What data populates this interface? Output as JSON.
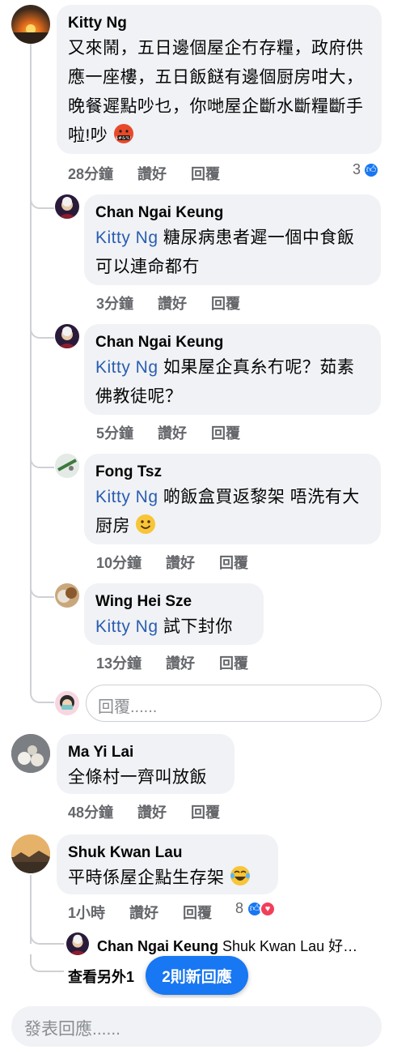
{
  "comments": [
    {
      "author": "Kitty Ng",
      "text": "又來鬧，五日邊個屋企冇存糧，政府供應一座樓，五日飯餸有邊個厨房咁大，晚餐遲點吵乜，你哋屋企斷水斷糧斷手啦!吵",
      "emoji": "angry-cursing-emoji",
      "time": "28分鐘",
      "like_label": "讚好",
      "reply_label": "回覆",
      "reaction_count": "3"
    },
    {
      "author": "Chan Ngai Keung",
      "tag": "Kitty Ng",
      "text": " 糖尿病患者遲一個中食飯可以連命都冇",
      "time": "3分鐘",
      "like_label": "讚好",
      "reply_label": "回覆"
    },
    {
      "author": "Chan Ngai Keung",
      "tag": "Kitty Ng",
      "text": " 如果屋企真糸冇呢？茹素佛教徒呢？",
      "time": "5分鐘",
      "like_label": "讚好",
      "reply_label": "回覆"
    },
    {
      "author": "Fong Tsz",
      "tag": "Kitty Ng",
      "text": " 啲飯盒買返黎架 唔洗有大厨房",
      "emoji": "smile-emoji",
      "time": "10分鐘",
      "like_label": "讚好",
      "reply_label": "回覆"
    },
    {
      "author": "Wing Hei Sze",
      "tag": "Kitty Ng",
      "text": " 試下封你",
      "time": "13分鐘",
      "like_label": "讚好",
      "reply_label": "回覆"
    },
    {
      "author": "Ma Yi Lai",
      "text": "全條村一齊叫放飯",
      "time": "48分鐘",
      "like_label": "讚好",
      "reply_label": "回覆"
    },
    {
      "author": "Shuk Kwan Lau",
      "text": "平時係屋企點生存架",
      "emoji": "tears-of-joy-emoji",
      "time": "1小時",
      "like_label": "讚好",
      "reply_label": "回覆",
      "reaction_count": "8"
    }
  ],
  "reply_input_placeholder": "回覆......",
  "collapsed_reply": {
    "author": "Chan Ngai Keung",
    "preview": " Shuk Kwan Lau 好…"
  },
  "view_more": "查看另外1",
  "new_replies_button": "2則新回應",
  "bottom_input_placeholder": "發表回應......",
  "colors": {
    "tag": "#2a5db0",
    "like": "#1877f2",
    "love": "#f33e58",
    "bubble": "#f0f2f5"
  }
}
